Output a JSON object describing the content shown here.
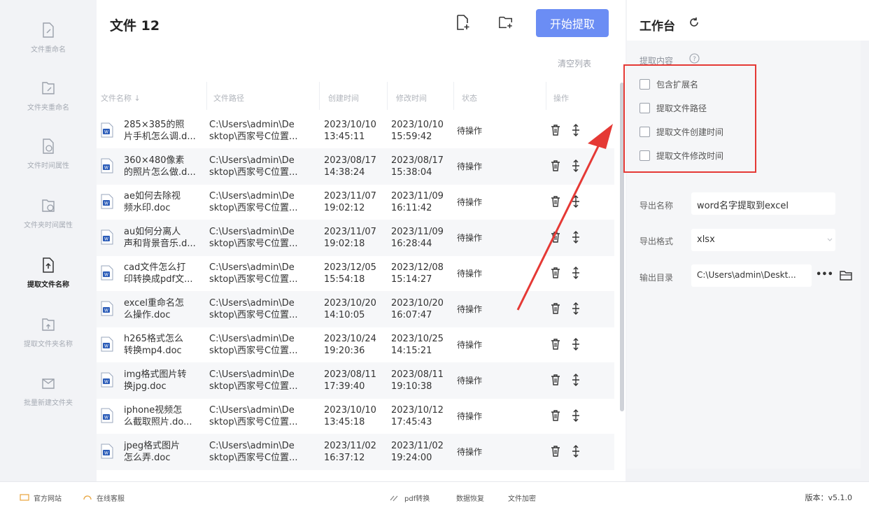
{
  "nav": [
    {
      "label": "文件重命名",
      "icon": "file-rename-icon",
      "active": false
    },
    {
      "label": "文件夹重命名",
      "icon": "folder-rename-icon",
      "active": false
    },
    {
      "label": "文件时间属性",
      "icon": "file-time-icon",
      "active": false
    },
    {
      "label": "文件夹时间属性",
      "icon": "folder-time-icon",
      "active": false
    },
    {
      "label": "提取文件名称",
      "icon": "extract-file-name-icon",
      "active": true
    },
    {
      "label": "提取文件夹名称",
      "icon": "extract-folder-name-icon",
      "active": false
    },
    {
      "label": "批量新建文件夹",
      "icon": "batch-new-folder-icon",
      "active": false
    }
  ],
  "main": {
    "title": "文件 12",
    "start_label": "开始提取",
    "clear_label": "清空列表",
    "columns": [
      "文件名称 ↓",
      "文件路径",
      "创建时间",
      "修改时间",
      "状态",
      "操作"
    ],
    "rows": [
      {
        "name1": "285×385的照",
        "name2": "片手机怎么调.d...",
        "path1": "C:\\Users\\admin\\De",
        "path2": "sktop\\西家号C位置...",
        "ct1": "2023/10/10",
        "ct2": "13:45:11",
        "mt1": "2023/10/10",
        "mt2": "15:59:42",
        "status": "待操作"
      },
      {
        "name1": "360×480像素",
        "name2": "的照片怎么做.d...",
        "path1": "C:\\Users\\admin\\De",
        "path2": "sktop\\西家号C位置...",
        "ct1": "2023/08/17",
        "ct2": "14:38:24",
        "mt1": "2023/08/17",
        "mt2": "15:38:04",
        "status": "待操作"
      },
      {
        "name1": "ae如何去除视",
        "name2": "频水印.doc",
        "path1": "C:\\Users\\admin\\De",
        "path2": "sktop\\西家号C位置...",
        "ct1": "2023/11/07",
        "ct2": "19:02:12",
        "mt1": "2023/11/09",
        "mt2": "16:11:42",
        "status": "待操作"
      },
      {
        "name1": "au如何分离人",
        "name2": "声和背景音乐.d...",
        "path1": "C:\\Users\\admin\\De",
        "path2": "sktop\\西家号C位置...",
        "ct1": "2023/11/07",
        "ct2": "19:02:18",
        "mt1": "2023/11/09",
        "mt2": "16:28:44",
        "status": "待操作"
      },
      {
        "name1": "cad文件怎么打",
        "name2": "印转换成pdf文...",
        "path1": "C:\\Users\\admin\\De",
        "path2": "sktop\\西家号C位置...",
        "ct1": "2023/12/05",
        "ct2": "15:54:18",
        "mt1": "2023/12/08",
        "mt2": "15:14:27",
        "status": "待操作"
      },
      {
        "name1": "excel重命名怎",
        "name2": "么操作.doc",
        "path1": "C:\\Users\\admin\\De",
        "path2": "sktop\\西家号C位置...",
        "ct1": "2023/10/20",
        "ct2": "14:10:05",
        "mt1": "2023/10/20",
        "mt2": "16:07:47",
        "status": "待操作"
      },
      {
        "name1": "h265格式怎么",
        "name2": "转换mp4.doc",
        "path1": "C:\\Users\\admin\\De",
        "path2": "sktop\\西家号C位置...",
        "ct1": "2023/10/24",
        "ct2": "19:20:36",
        "mt1": "2023/10/25",
        "mt2": "14:15:21",
        "status": "待操作"
      },
      {
        "name1": "img格式图片转",
        "name2": "换jpg.doc",
        "path1": "C:\\Users\\admin\\De",
        "path2": "sktop\\西家号C位置...",
        "ct1": "2023/08/11",
        "ct2": "17:39:40",
        "mt1": "2023/08/11",
        "mt2": "19:10:38",
        "status": "待操作"
      },
      {
        "name1": "iphone视频怎",
        "name2": "么截取照片.do...",
        "path1": "C:\\Users\\admin\\De",
        "path2": "sktop\\西家号C位置...",
        "ct1": "2023/10/10",
        "ct2": "13:45:18",
        "mt1": "2023/10/12",
        "mt2": "17:45:43",
        "status": "待操作"
      },
      {
        "name1": "jpeg格式图片",
        "name2": "怎么弄.doc",
        "path1": "C:\\Users\\admin\\De",
        "path2": "sktop\\西家号C位置...",
        "ct1": "2023/11/02",
        "ct2": "16:37:12",
        "mt1": "2023/11/02",
        "mt2": "19:24:00",
        "status": "待操作"
      }
    ]
  },
  "side": {
    "title": "工作台",
    "section_label": "提取内容",
    "options": [
      {
        "label": "包含扩展名",
        "checked": false
      },
      {
        "label": "提取文件路径",
        "checked": false
      },
      {
        "label": "提取文件创建时间",
        "checked": false
      },
      {
        "label": "提取文件修改时间",
        "checked": false
      }
    ],
    "export_name_label": "导出名称",
    "export_name_value": "word名字提取到excel",
    "export_format_label": "导出格式",
    "export_format_value": "xlsx",
    "output_dir_label": "输出目录",
    "output_dir_value": "C:\\Users\\admin\\Deskt...",
    "more_label": "•••"
  },
  "footer": {
    "website": "官方网站",
    "support": "在线客服",
    "pdf": "pdf转换",
    "recovery": "数据恢复",
    "encrypt": "文件加密",
    "version": "版本：v5.1.0"
  },
  "colors": {
    "accent": "#6b8df4",
    "highlight": "#e53935",
    "word_blue": "#2b5cb8"
  }
}
